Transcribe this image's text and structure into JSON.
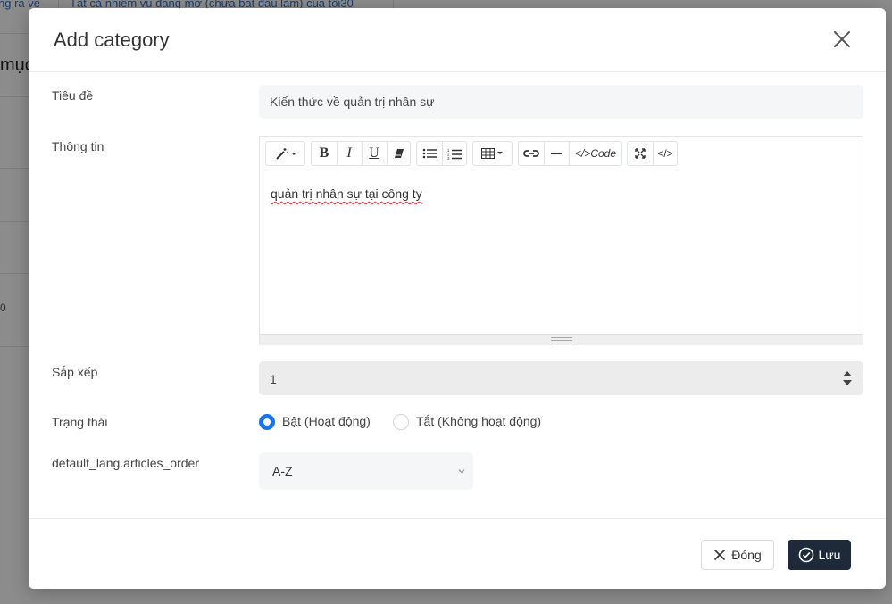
{
  "background": {
    "link_left": "ng ra ve",
    "link_right": "Tất cả nhiệm vụ đang mở (chưa bắt đầu làm) của tôi30",
    "heading": "mục",
    "small": "0"
  },
  "modal": {
    "title": "Add category",
    "fields": {
      "title_label": "Tiêu đề",
      "title_value": "Kiến thức về quản trị nhân sự",
      "info_label": "Thông tin",
      "editor_content": "quản trị nhân sự tại công ty",
      "order_label": "Sắp xếp",
      "order_value": "1",
      "status_label": "Trạng thái",
      "status_on": "Bật (Hoạt động)",
      "status_off": "Tắt (Không hoạt động)",
      "status_selected": "on",
      "sort_label": "default_lang.articles_order",
      "sort_value": "A-Z"
    },
    "toolbar": {
      "code_label": "</>Code",
      "codeview_label": "</>"
    },
    "footer": {
      "close_label": "Đóng",
      "save_label": "Lưu"
    }
  },
  "colors": {
    "accent": "#1a73e8",
    "save_button": "#1e2a3a"
  }
}
